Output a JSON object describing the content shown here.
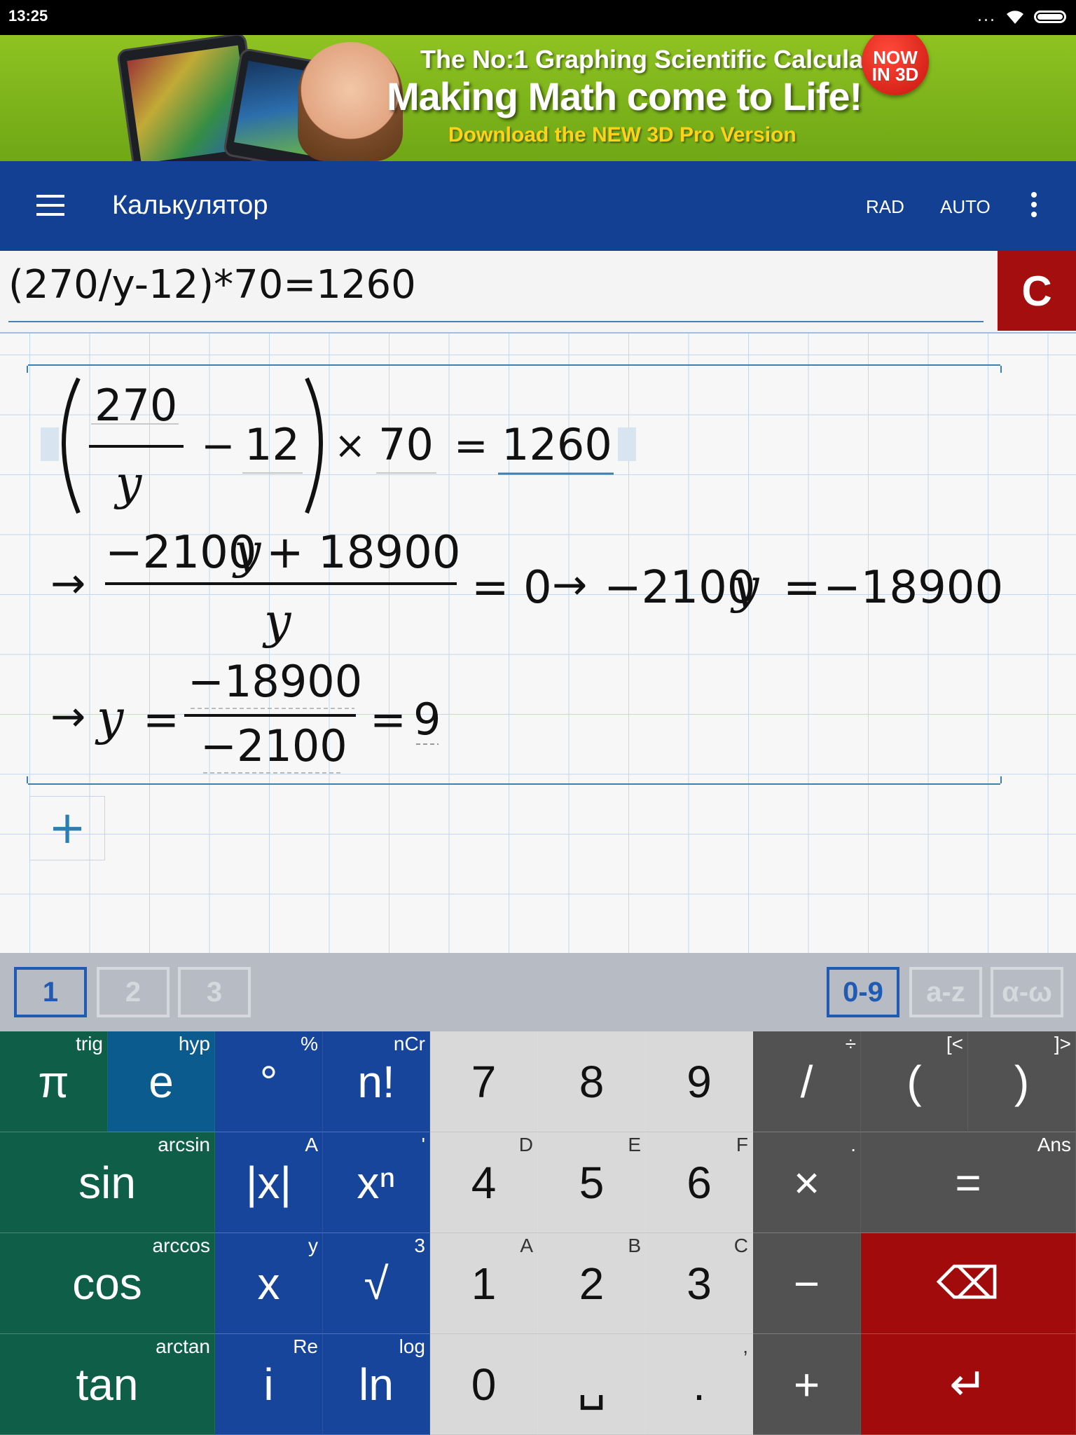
{
  "status_bar": {
    "time": "13:25",
    "dots": "..."
  },
  "ad": {
    "line1": "The No:1 Graphing Scientific Calculator",
    "line2": "Making Math come to Life!",
    "line3": "Download the NEW 3D Pro Version",
    "badge_line1": "NOW",
    "badge_line2": "IN 3D",
    "colors": {
      "background": "#7cb51a",
      "accent": "#ffd21a",
      "badge": "#d8170f"
    }
  },
  "app_bar": {
    "title": "Калькулятор",
    "angle_mode": "RAD",
    "mode": "AUTO",
    "color": "#134092"
  },
  "input": {
    "value": "(270/y-12)*70=1260",
    "clear_label": "C"
  },
  "result": {
    "line1": {
      "numerator": "270",
      "denominator": "y",
      "minus": "−",
      "term2": "12",
      "times": "×",
      "multiplier": "70",
      "equals": "=",
      "rhs": "1260"
    },
    "line2": {
      "arrow": "→",
      "numerator_coef": "−2100",
      "numerator_var": "y",
      "numerator_plus": "+ 18900",
      "denominator": "y",
      "equals_zero": "= 0",
      "arrow2": "→",
      "lhs_coef": "−2100",
      "lhs_var": "y",
      "equals": "=",
      "rhs": "−18900"
    },
    "line3": {
      "arrow": "→",
      "var": "y",
      "equals": "=",
      "numerator": "−18900",
      "denominator": "−2100",
      "equals2": "=",
      "answer": "9"
    }
  },
  "add_button": "+",
  "keyboard_pages": {
    "left": [
      "1",
      "2",
      "3"
    ],
    "right": [
      "0-9",
      "a-z",
      "α-ω"
    ],
    "active_left": "1",
    "active_right": "0-9"
  },
  "keys": [
    [
      {
        "main": "π",
        "sub": "trig",
        "color": "green"
      },
      {
        "main": "e",
        "sub": "hyp",
        "color": "teal"
      },
      {
        "main": "°",
        "sub": "%",
        "color": "blue"
      },
      {
        "main": "n!",
        "sub": "nCr",
        "color": "blue"
      },
      {
        "main": "7",
        "sub": "",
        "color": "light"
      },
      {
        "main": "8",
        "sub": "",
        "color": "light"
      },
      {
        "main": "9",
        "sub": "",
        "color": "light"
      },
      {
        "main": "/",
        "sub": "÷",
        "color": "gray"
      },
      {
        "main": "(",
        "sub": "[<",
        "color": "gray"
      },
      {
        "main": ")",
        "sub": "]>",
        "color": "gray"
      }
    ],
    [
      {
        "main": "sin",
        "sub": "arcsin",
        "color": "green",
        "span": 2
      },
      {
        "main": "|x|",
        "sub": "A",
        "color": "blue"
      },
      {
        "main": "xⁿ",
        "sub": "'",
        "color": "blue"
      },
      {
        "main": "4",
        "sub": "D",
        "color": "light"
      },
      {
        "main": "5",
        "sub": "E",
        "color": "light"
      },
      {
        "main": "6",
        "sub": "F",
        "color": "light"
      },
      {
        "main": "×",
        "sub": ".",
        "color": "gray"
      },
      {
        "main": "=",
        "sub": "Ans",
        "color": "gray",
        "span": 2
      }
    ],
    [
      {
        "main": "cos",
        "sub": "arccos",
        "color": "green",
        "span": 2
      },
      {
        "main": "x",
        "sub": "y",
        "color": "blue"
      },
      {
        "main": "√",
        "sub": "3",
        "color": "blue"
      },
      {
        "main": "1",
        "sub": "A",
        "color": "light"
      },
      {
        "main": "2",
        "sub": "B",
        "color": "light"
      },
      {
        "main": "3",
        "sub": "C",
        "color": "light"
      },
      {
        "main": "−",
        "sub": "",
        "color": "gray"
      },
      {
        "main": "⌫",
        "sub": "",
        "color": "red",
        "span": 2
      }
    ],
    [
      {
        "main": "tan",
        "sub": "arctan",
        "color": "green",
        "span": 2
      },
      {
        "main": "i",
        "sub": "Re",
        "color": "blue"
      },
      {
        "main": "ln",
        "sub": "log",
        "color": "blue"
      },
      {
        "main": "0",
        "sub": "",
        "color": "light"
      },
      {
        "main": "␣",
        "sub": "",
        "color": "light"
      },
      {
        "main": ".",
        "sub": ",",
        "color": "light"
      },
      {
        "main": "+",
        "sub": "",
        "color": "gray"
      },
      {
        "main": "↵",
        "sub": "",
        "color": "red",
        "span": 2
      }
    ]
  ]
}
